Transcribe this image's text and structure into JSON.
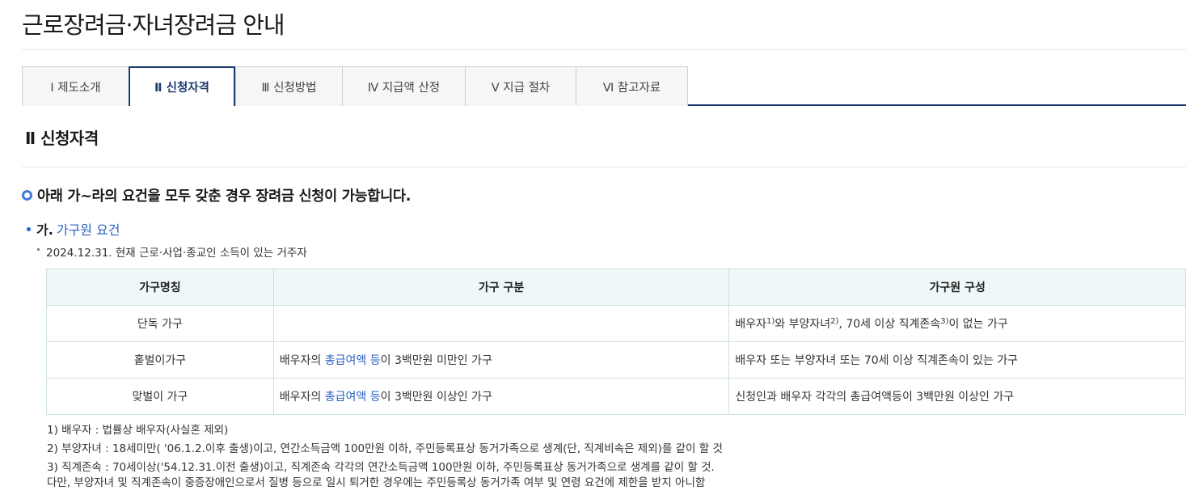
{
  "page_title": "근로장려금·자녀장려금 안내",
  "tabs": [
    {
      "label": "Ⅰ  제도소개",
      "active": false
    },
    {
      "label": "Ⅱ  신청자격",
      "active": true
    },
    {
      "label": "Ⅲ  신청방법",
      "active": false
    },
    {
      "label": "Ⅳ  지급액 산정",
      "active": false
    },
    {
      "label": "Ⅴ  지급 절차",
      "active": false
    },
    {
      "label": "Ⅵ  참고자료",
      "active": false
    }
  ],
  "section_title": "Ⅱ 신청자격",
  "notice": "아래 가~라의 요건을 모두 갖춘 경우 장려금 신청이 가능합니다.",
  "sub_heading": {
    "prefix": "가.",
    "title": "가구원 요건"
  },
  "criteria": "2024.12.31. 현재 근로·사업·종교인 소득이 있는 거주자",
  "table": {
    "headers": [
      "가구명칭",
      "가구 구분",
      "가구원 구성"
    ],
    "rows": [
      {
        "name": "단독 가구",
        "division": {
          "pre": "",
          "link": "",
          "post": ""
        },
        "composition": {
          "a": "배우자",
          "s1": "1)",
          "b": "와 부양자녀",
          "s2": "2)",
          "c": ", 70세 이상 직계존속",
          "s3": "3)",
          "d": "이 없는 가구"
        }
      },
      {
        "name": "홑벌이가구",
        "division": {
          "pre": "배우자의 ",
          "link": "총급여액 등",
          "post": "이 3백만원 미만인 가구"
        },
        "composition_text": "배우자 또는 부양자녀 또는 70세 이상 직계존속이 있는 가구"
      },
      {
        "name": "맞벌이 가구",
        "division": {
          "pre": "배우자의 ",
          "link": "총급여액 등",
          "post": "이 3백만원 이상인 가구"
        },
        "composition_text": "신청인과 배우자 각각의 총급여액등이 3백만원 이상인 가구"
      }
    ]
  },
  "notes": [
    "1) 배우자 : 법률상 배우자(사실혼 제외)",
    "2) 부양자녀 : 18세미만( '06.1.2.이후 출생)이고, 연간소득금액 100만원 이하, 주민등록표상 동거가족으로 생계(단, 직계비속은 제외)를 같이 할 것",
    "3) 직계존속 : 70세이상('54.12.31.이전 출생)이고, 직계존속 각각의 연간소득금액 100만원 이하, 주민등록표상 동거가족으로 생계를 같이 할 것.",
    "다만, 부양자녀 및 직계존속이 중증장애인으로서 질병 등으로 일시 퇴거한 경우에는 주민등록상 동거가족 여부 및 연령 요건에 제한을 받지 아니함"
  ],
  "colors": {
    "accent_navy": "#1b3a6e",
    "link_blue": "#2a62c4",
    "header_bg": "#eef8f8"
  }
}
